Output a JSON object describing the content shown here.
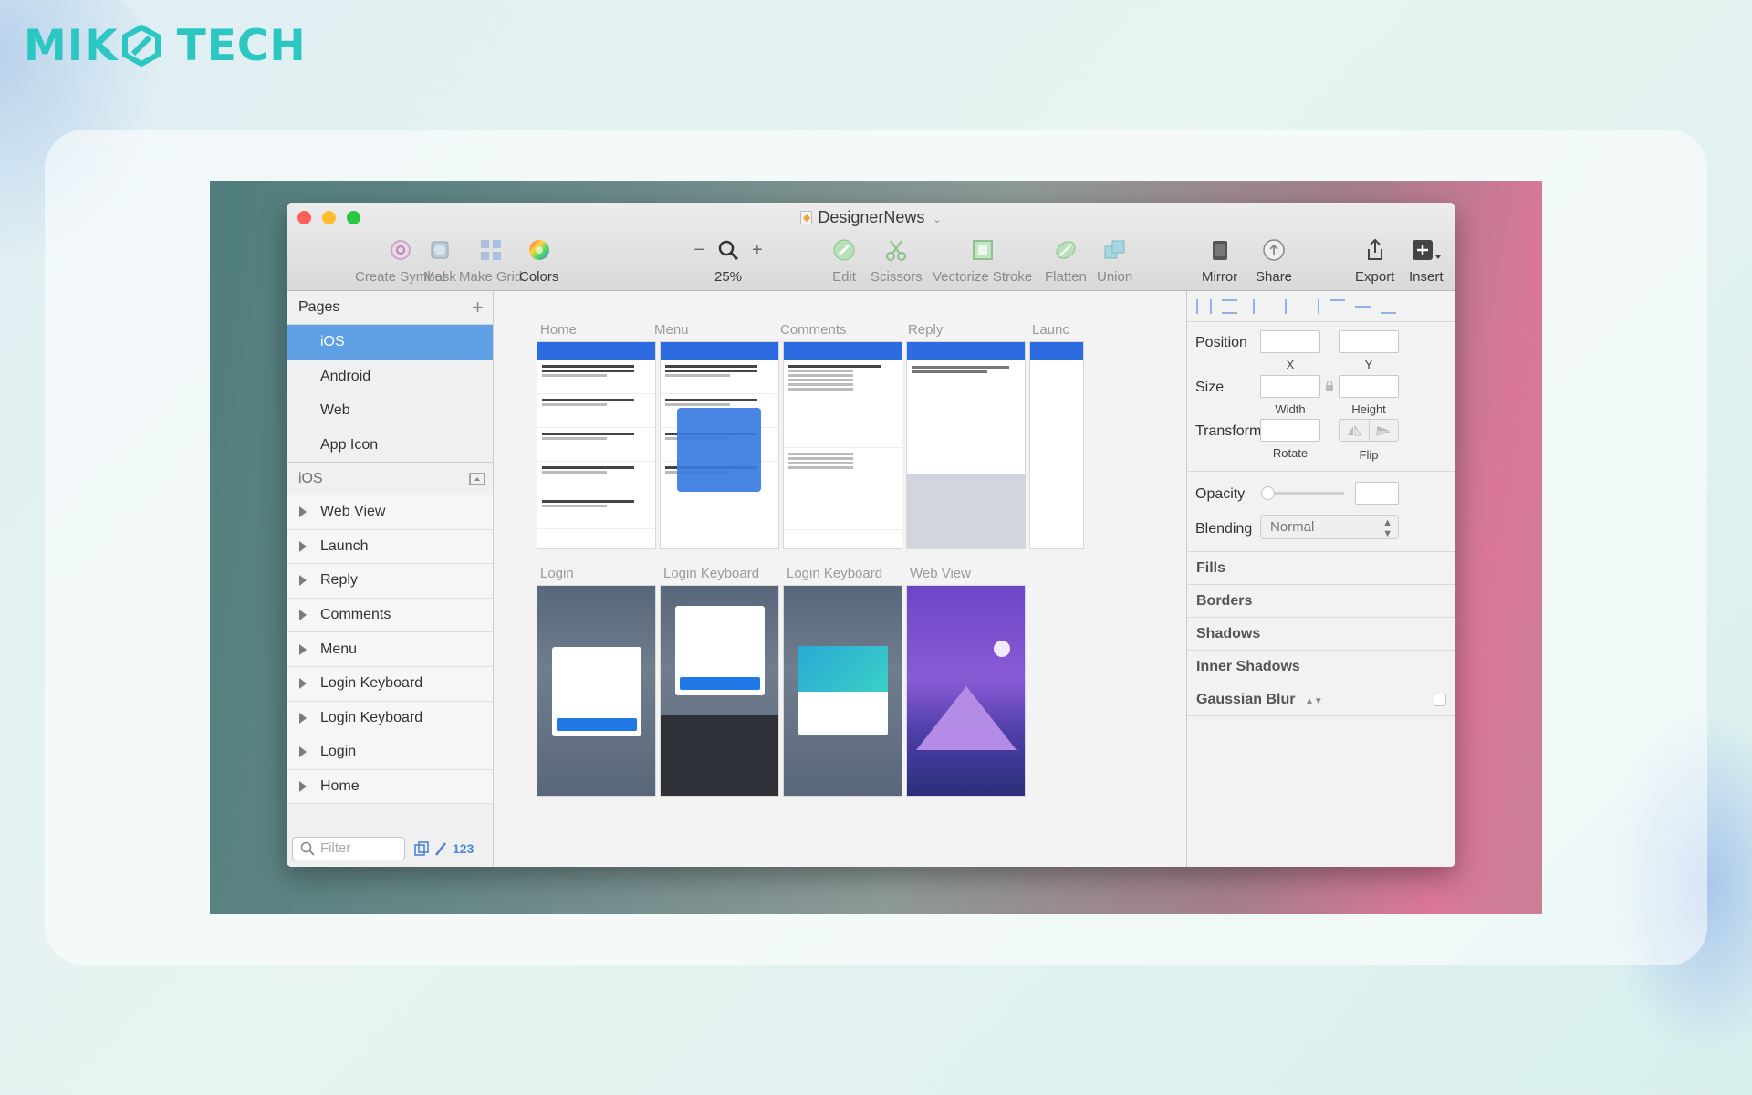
{
  "brand": {
    "left": "MIK",
    "right": "TECH",
    "color": "#2cc7c2"
  },
  "window": {
    "title": "DesignerNews"
  },
  "toolbar": {
    "create_symbol": "Create Symbol",
    "mask": "Mask",
    "make_grid": "Make Grid",
    "colors": "Colors",
    "zoom_minus": "−",
    "zoom_plus": "+",
    "zoom_value": "25%",
    "edit": "Edit",
    "scissors": "Scissors",
    "vectorize_stroke": "Vectorize Stroke",
    "flatten": "Flatten",
    "union": "Union",
    "mirror": "Mirror",
    "share": "Share",
    "export": "Export",
    "insert": "Insert"
  },
  "sidebar": {
    "pages_title": "Pages",
    "pages": [
      {
        "label": "iOS",
        "selected": true
      },
      {
        "label": "Android"
      },
      {
        "label": "Web"
      },
      {
        "label": "App Icon"
      }
    ],
    "current_page": "iOS",
    "layers": [
      "Web View",
      "Launch",
      "Reply",
      "Comments",
      "Menu",
      "Login Keyboard",
      "Login Keyboard",
      "Login",
      "Home"
    ],
    "filter_placeholder": "Filter",
    "count_label": "123"
  },
  "canvas": {
    "artboards_row1": [
      "Home",
      "Menu",
      "Comments",
      "Reply",
      "Launc"
    ],
    "artboards_row2": [
      "Login",
      "Login Keyboard",
      "Login Keyboard",
      "Web View"
    ],
    "accent": "#2d6ce0"
  },
  "inspector": {
    "position": "Position",
    "x": "X",
    "y": "Y",
    "size": "Size",
    "width": "Width",
    "height": "Height",
    "transform": "Transform",
    "rotate": "Rotate",
    "flip": "Flip",
    "opacity": "Opacity",
    "blending": "Blending",
    "blending_value": "Normal",
    "sections": [
      "Fills",
      "Borders",
      "Shadows",
      "Inner Shadows",
      "Gaussian Blur"
    ]
  }
}
